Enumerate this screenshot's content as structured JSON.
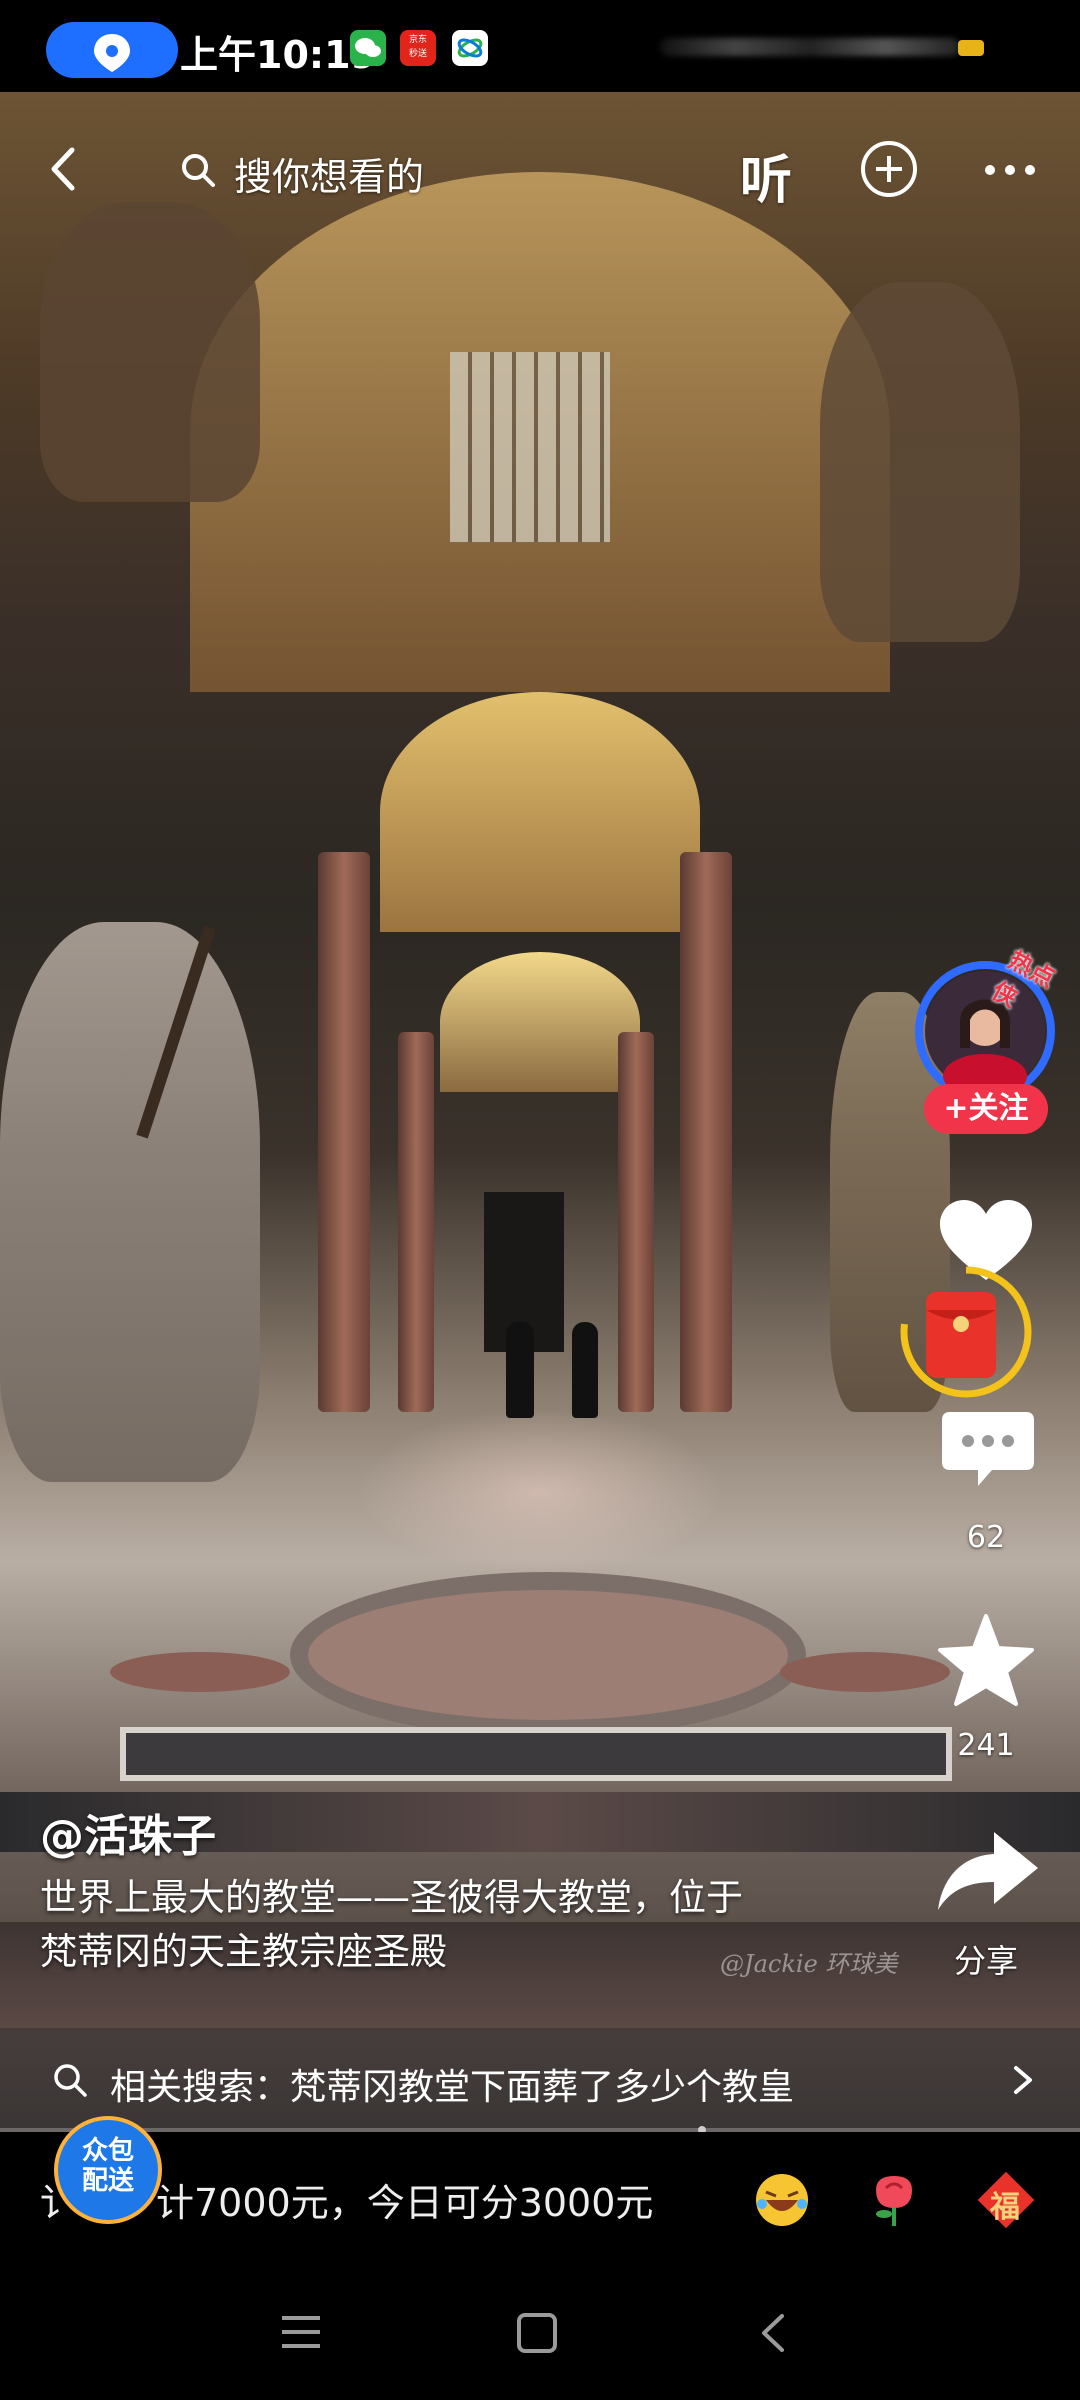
{
  "status_bar": {
    "time": "上午10:19",
    "app_badge_text": "京东\n秒送"
  },
  "top_nav": {
    "search_placeholder": "搜你想看的",
    "listen_label": "听"
  },
  "video": {
    "watermark": "@Jackie 环球美"
  },
  "creator": {
    "badge_text": "热点侠",
    "follow_label": "+关注"
  },
  "actions": {
    "comment_count": "62",
    "favorite_count": "241",
    "share_label": "分享"
  },
  "caption": {
    "username": "@活珠子",
    "description_line1": "世界上最大的教堂——圣彼得大教堂，位于",
    "description_line2": "梵蒂冈的天主教宗座圣殿"
  },
  "related_search": {
    "text": "相关搜索：梵蒂冈教堂下面葬了多少个教皇"
  },
  "bottom_bar": {
    "badge_line1": "众包",
    "badge_line2": "配送",
    "promo_text": "计7000元，今日可分3000元",
    "promo_prefix": "讠",
    "fu_label": "福"
  },
  "colors": {
    "accent_red": "#f2344b",
    "location_blue": "#1e6fff",
    "gold": "#f3c31b"
  }
}
